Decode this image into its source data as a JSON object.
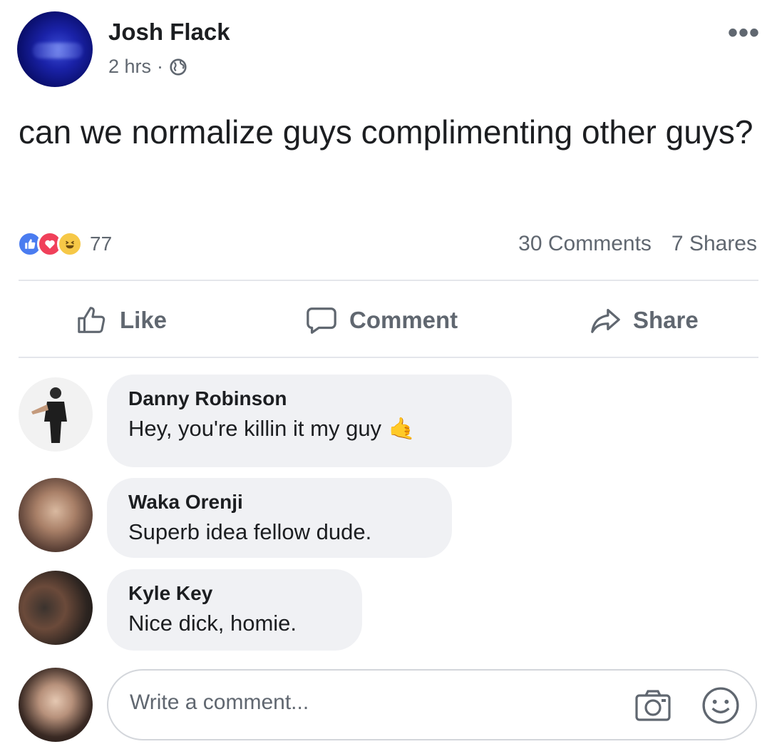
{
  "post": {
    "author": "Josh Flack",
    "time": "2 hrs",
    "separator": "·",
    "privacy_icon": "globe-icon",
    "more_label": "•••",
    "text": "can we normalize guys complimenting other guys?",
    "reaction_count": "77",
    "comments_count": "30 Comments",
    "shares_count": "7 Shares"
  },
  "actions": {
    "like": "Like",
    "comment": "Comment",
    "share": "Share"
  },
  "comments": [
    {
      "name": "Danny Robinson",
      "text": "Hey, you're killin it my guy",
      "emoji": "🤙"
    },
    {
      "name": "Waka Orenji",
      "text": "Superb idea fellow dude."
    },
    {
      "name": "Kyle Key",
      "text": "Nice dick, homie."
    }
  ],
  "composer": {
    "placeholder": "Write a comment..."
  },
  "colors": {
    "text": "#1c1e21",
    "secondary": "#606770",
    "bubble": "#f0f1f4",
    "like_blue": "#4a7cf0",
    "love_red": "#f0405a",
    "haha_yellow": "#f6c847"
  }
}
